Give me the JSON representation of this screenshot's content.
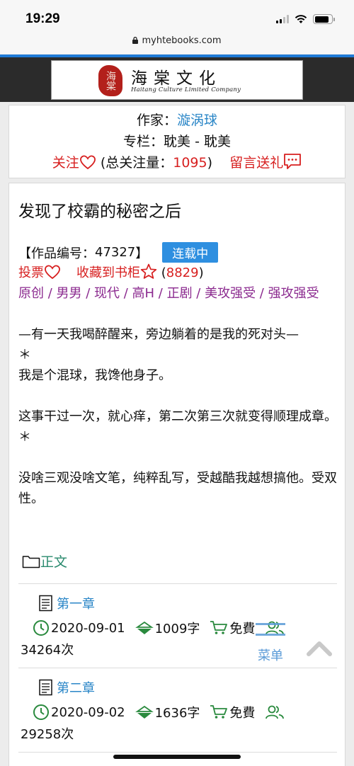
{
  "status_bar": {
    "time": "19:29"
  },
  "browser": {
    "url": "myhtebooks.com"
  },
  "header": {
    "seal_text": "海棠",
    "logo_cn": "海棠文化",
    "logo_en": "Haitang Culture Limited Company"
  },
  "author": {
    "label": "作家：",
    "name": "漩涡球",
    "column_label": "专栏：",
    "column_value": "耽美 - 耽美",
    "follow_label": "关注",
    "follow_count_prefix": "(总关注量：",
    "follow_count": "1095",
    "follow_count_suffix": ")",
    "message_label": "留言送礼"
  },
  "work": {
    "title": "发现了校霸的秘密之后",
    "id_prefix": "【作品编号：",
    "id": "47327",
    "id_suffix": "】",
    "status": "连载中",
    "vote_label": "投票",
    "bookshelf_label": "收藏到书柜",
    "bookshelf_count_prefix": "(",
    "bookshelf_count": "8829",
    "bookshelf_count_suffix": ")",
    "tags": "原创 / 男男 / 现代 / 高H / 正剧 / 美攻强受 / 强攻强受",
    "synopsis": "—有一天我喝醉醒来，旁边躺着的是我的死对头—\n＊\n我是个混球，我馋他身子。\n\n这事干过一次，就心痒，第二次第三次就变得顺理成章。\n＊\n\n没啥三观没啥文笔，纯粹乱写，受越酷我越想搞他。受双性。",
    "section_label": "正文"
  },
  "chapters": [
    {
      "title": "第一章",
      "date": "2020-09-01",
      "words": "1009字",
      "price": "免費",
      "views": "34264次"
    },
    {
      "title": "第二章",
      "date": "2020-09-02",
      "words": "1636字",
      "price": "免費",
      "views": "29258次"
    }
  ],
  "menu_button": {
    "label": "菜单"
  },
  "colors": {
    "link": "#2a86c7",
    "accent_red": "#d71f1f",
    "tag_purple": "#8b2a8f",
    "green": "#2a8a3e",
    "badge_blue": "#2e8fe0"
  }
}
